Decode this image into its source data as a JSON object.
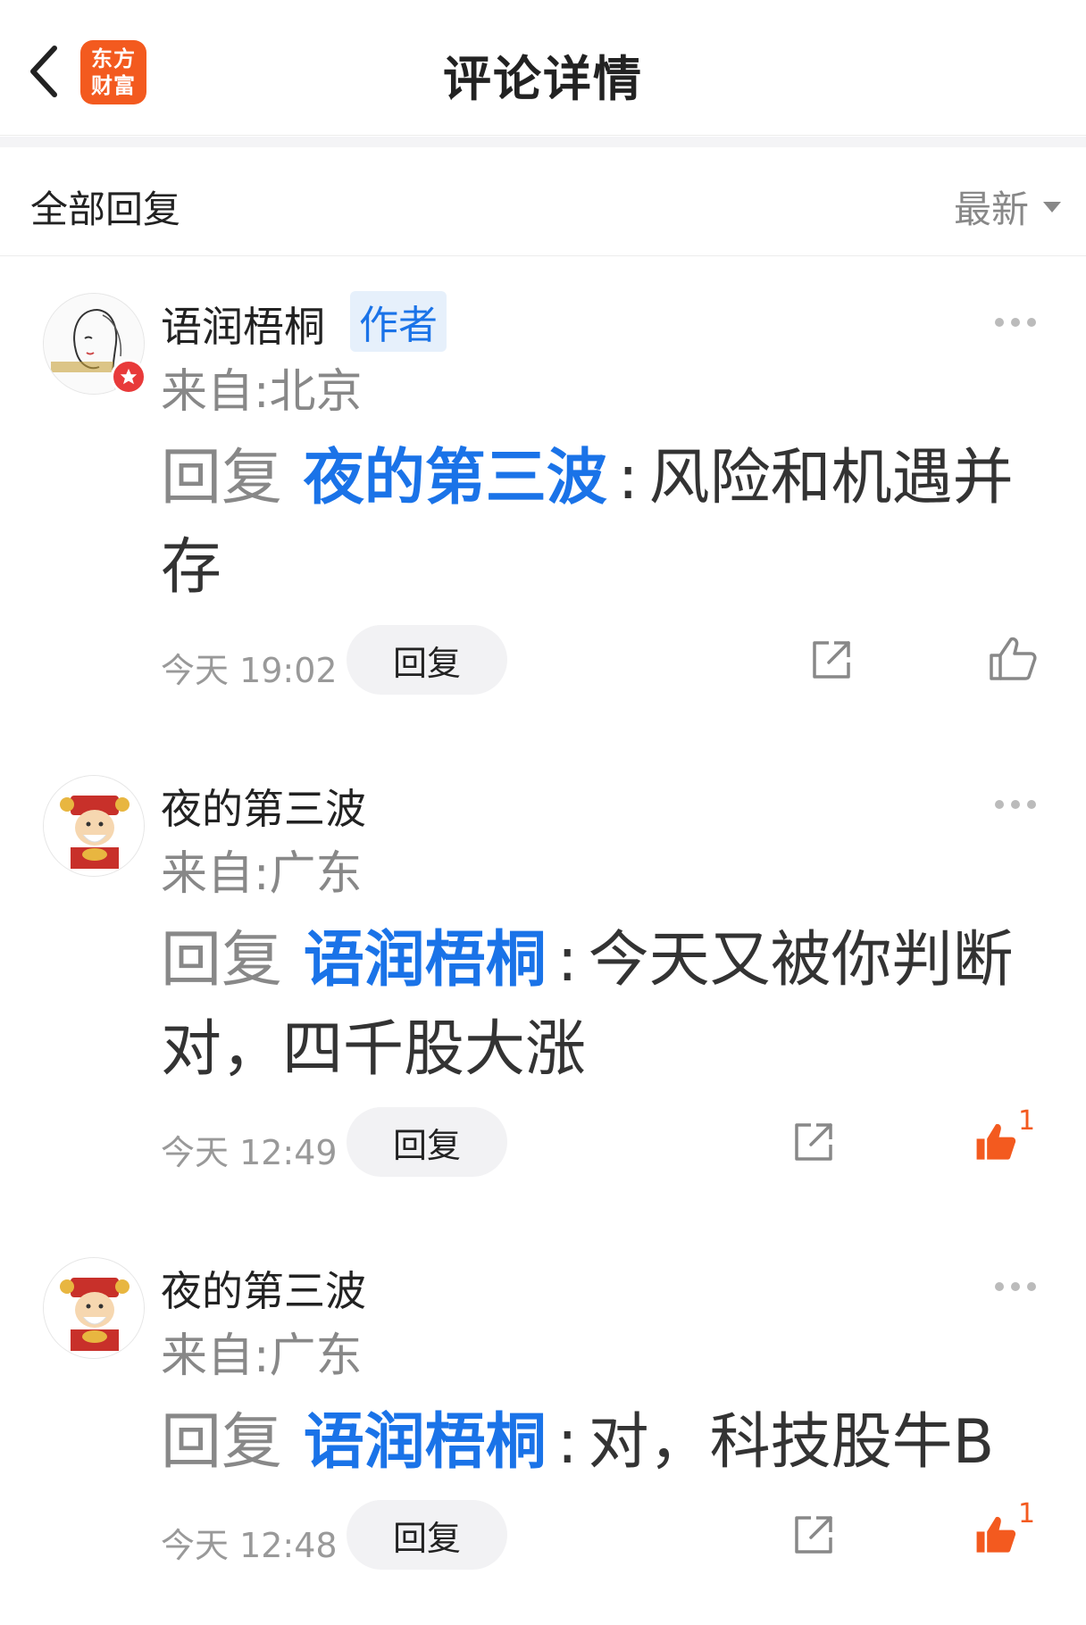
{
  "header": {
    "title": "评论详情",
    "logo_line1": "东方",
    "logo_line2": "财富",
    "brand_color": "#f35a1f"
  },
  "sort_bar": {
    "label": "全部回复",
    "selected": "最新"
  },
  "comments": [
    {
      "username": "语润梧桐",
      "tag": "作者",
      "location": "来自:北京",
      "reply_keyword": "回复",
      "reply_target": "夜的第三波",
      "separator": ":",
      "text": "风险和机遇并存",
      "time": "今天 19:02",
      "reply_label": "回复",
      "liked": false,
      "like_count": ""
    },
    {
      "username": "夜的第三波",
      "location": "来自:广东",
      "reply_keyword": "回复",
      "reply_target": "语润梧桐",
      "separator": ":",
      "text": "今天又被你判断对，四千股大涨",
      "time": "今天 12:49",
      "reply_label": "回复",
      "liked": true,
      "like_count": "1"
    },
    {
      "username": "夜的第三波",
      "location": "来自:广东",
      "reply_keyword": "回复",
      "reply_target": "语润梧桐",
      "separator": ":",
      "text": "对，科技股牛B",
      "time": "今天 12:48",
      "reply_label": "回复",
      "liked": true,
      "like_count": "1"
    }
  ],
  "icons": {
    "back": "chevron-left-icon",
    "more": "more-dots-icon",
    "share": "share-icon",
    "like": "thumbs-up-icon"
  },
  "colors": {
    "link": "#1a73e8",
    "like_active": "#f35a1f",
    "muted": "#888888"
  }
}
